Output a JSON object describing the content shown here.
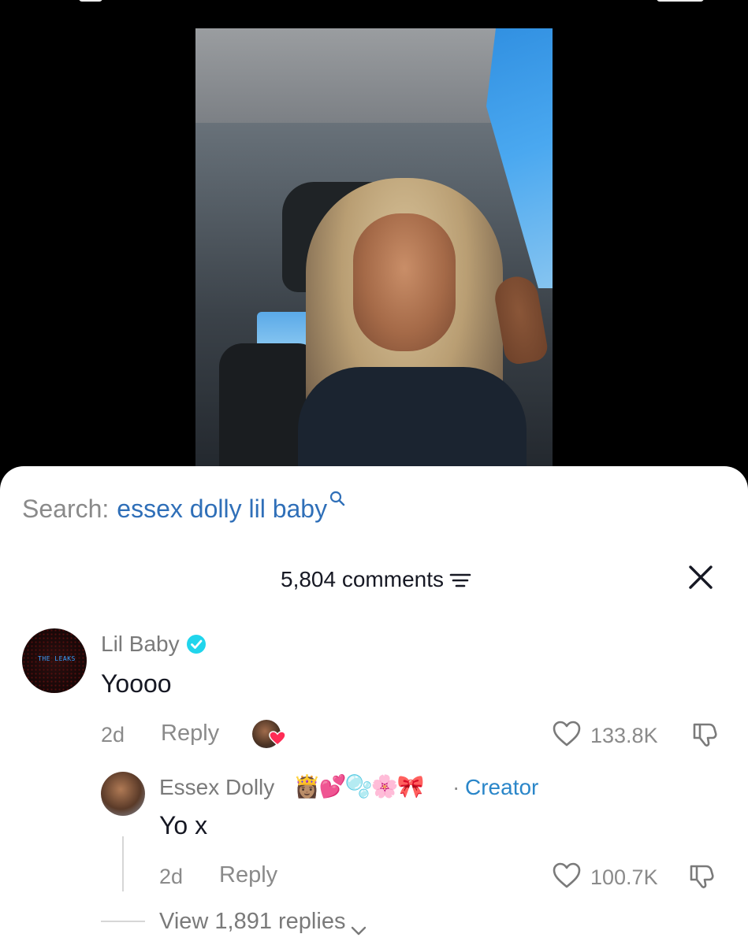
{
  "search": {
    "label": "Search:",
    "query": "essex dolly lil baby"
  },
  "comments_header": {
    "count_label": "5,804 comments"
  },
  "comments": [
    {
      "username": "Lil Baby",
      "verified": true,
      "avatar_text": "THE LEAKS",
      "text": "Yoooo",
      "age": "2d",
      "reply_label": "Reply",
      "likes": "133.8K"
    }
  ],
  "reply": {
    "username": "Essex Dolly",
    "emojis": "👸🏽💕🫧🌸🎀",
    "separator": "·",
    "badge": "Creator",
    "text": "Yo x",
    "age": "2d",
    "reply_label": "Reply",
    "likes": "100.7K"
  },
  "view_replies_label": "View 1,891 replies",
  "colors": {
    "accent_blue": "#2a86c9",
    "search_query": "#2f6fb8",
    "muted": "#8a8a8a",
    "like_heart_red": "#fe2c55"
  }
}
